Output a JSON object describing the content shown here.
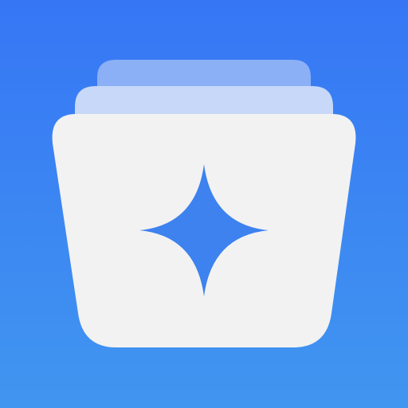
{
  "app_icon": {
    "name": "folder-sparkle-app-icon",
    "icon": "folder-stack-sparkle-icon",
    "colors": {
      "background_top": "#3676F5",
      "background_bottom": "#4196F0",
      "back_card": "#8CB0F6",
      "middle_card": "#C7D8F8",
      "front_card": "#F2F2F2",
      "sparkle": "#3D82EE"
    }
  }
}
